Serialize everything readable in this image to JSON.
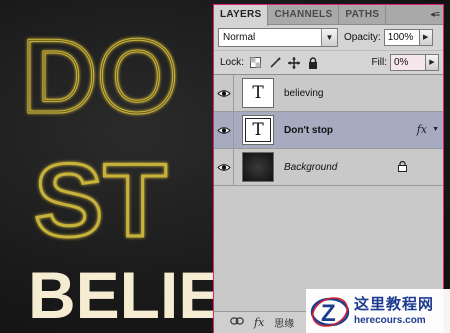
{
  "canvas": {
    "glow_word_1": "DO",
    "glow_word_2": "ST",
    "solid_word": "BELIE",
    "glow_color": "#c9b23a",
    "solid_color": "#f5ecd2"
  },
  "panel": {
    "tabs": [
      {
        "label": "LAYERS",
        "active": true
      },
      {
        "label": "CHANNELS",
        "active": false
      },
      {
        "label": "PATHS",
        "active": false
      }
    ],
    "menu_icon": "panel-menu-icon",
    "blend_mode": "Normal",
    "opacity_label": "Opacity:",
    "opacity_value": "100%",
    "lock_label": "Lock:",
    "fill_label": "Fill:",
    "fill_value": "0%",
    "layers": [
      {
        "name": "believing",
        "type": "text",
        "thumb": "T",
        "selected": false
      },
      {
        "name": "Don't stop",
        "type": "text",
        "thumb": "T",
        "selected": true,
        "fx": "fx"
      },
      {
        "name": "Background",
        "type": "background",
        "selected": false,
        "locked": true
      }
    ],
    "bottom_fx": "fx",
    "bottom_fragment": "思缘"
  },
  "watermark": {
    "title": "这里教程网",
    "url": "herecours.com"
  }
}
